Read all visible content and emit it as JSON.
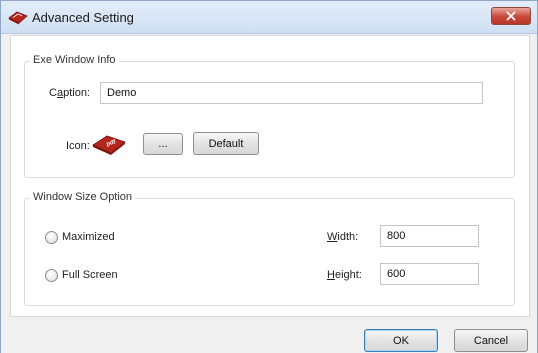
{
  "window": {
    "title": "Advanced Setting",
    "close_glyph": "x"
  },
  "exe_group": {
    "legend": "Exe Window Info",
    "caption_label": "Caption:",
    "caption_value": "Demo",
    "icon_label": "Icon:",
    "icon_name": "pdf-icon",
    "browse_label": "...",
    "default_label": "Default"
  },
  "size_group": {
    "legend": "Window Size Option",
    "options": [
      {
        "label": "Maximized",
        "selected": false
      },
      {
        "label": "Full Screen",
        "selected": false
      }
    ],
    "width_label": "Width:",
    "width_value": "800",
    "height_label": "Height:",
    "height_value": "600"
  },
  "footer": {
    "ok_label": "OK",
    "cancel_label": "Cancel"
  },
  "colors": {
    "titlebar": "#cfdff2",
    "close_button": "#c8473a",
    "icon_red": "#b3271f",
    "focus_border": "#3c7fb1"
  }
}
